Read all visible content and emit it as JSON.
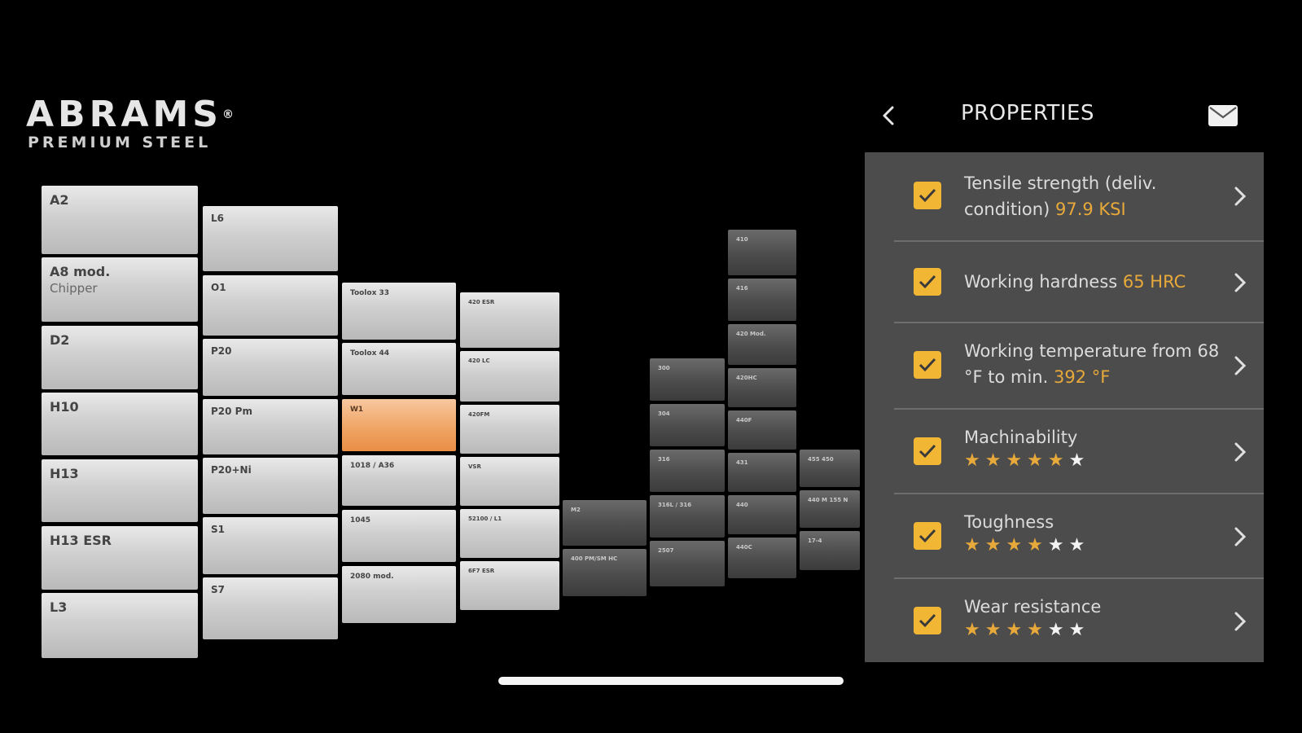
{
  "brand": {
    "name": "ABRAMS",
    "registered": "®",
    "tagline": "PREMIUM STEEL"
  },
  "panel": {
    "title": "PROPERTIES",
    "properties": [
      {
        "text": "Tensile strength (deliv. condition) ",
        "value": "97.9 KSI",
        "checked": true
      },
      {
        "text": "Working hardness ",
        "value": "65 HRC",
        "checked": true
      },
      {
        "text": "Working temperature from 68 °F to min. ",
        "value": "392 °F",
        "checked": true
      },
      {
        "text": "Machinability",
        "stars_on": "★★★★★",
        "stars_off": "★",
        "rating": 5,
        "max": 6,
        "checked": true
      },
      {
        "text": "Toughness",
        "stars_on": "★★★★",
        "stars_off": "★★",
        "rating": 4,
        "max": 6,
        "checked": true
      },
      {
        "text": "Wear resistance",
        "stars_on": "★★★★",
        "stars_off": "★★",
        "rating": 4,
        "max": 6,
        "checked": true
      }
    ]
  },
  "grid": {
    "selected": "W1",
    "col1": [
      {
        "code": "A2"
      },
      {
        "code": "A8 mod.",
        "sub": "Chipper"
      },
      {
        "code": "D2"
      },
      {
        "code": "H10"
      },
      {
        "code": "H13"
      },
      {
        "code": "H13 ESR"
      },
      {
        "code": "L3"
      }
    ],
    "col2": [
      "L6",
      "O1",
      "P20",
      "P20 Pm",
      "P20+Ni",
      "S1",
      "S7"
    ],
    "col3": [
      "Toolox 33",
      "Toolox 44",
      "W1",
      "1018 / A36",
      "1045",
      "2080 mod."
    ],
    "col4": [
      "420 ESR",
      "420 LC",
      "420FM",
      "VSR",
      "52100 / L1",
      "6F7 ESR"
    ],
    "col5": [
      "M2",
      "400 PM/SM HC"
    ],
    "col6": [
      "300",
      "304",
      "316",
      "316L / 316",
      "2507"
    ],
    "col7": [
      "410",
      "416",
      "420 Mod.",
      "420HC",
      "440F",
      "431",
      "440",
      "440C"
    ],
    "col8": [
      "455 450",
      "440 M 155 N",
      "17-4"
    ]
  },
  "colors": {
    "accent": "#e8a93b",
    "checkbox": "#f2b635",
    "selected_tile": "#f0a566",
    "panel_bg": "#4c4c4c"
  }
}
